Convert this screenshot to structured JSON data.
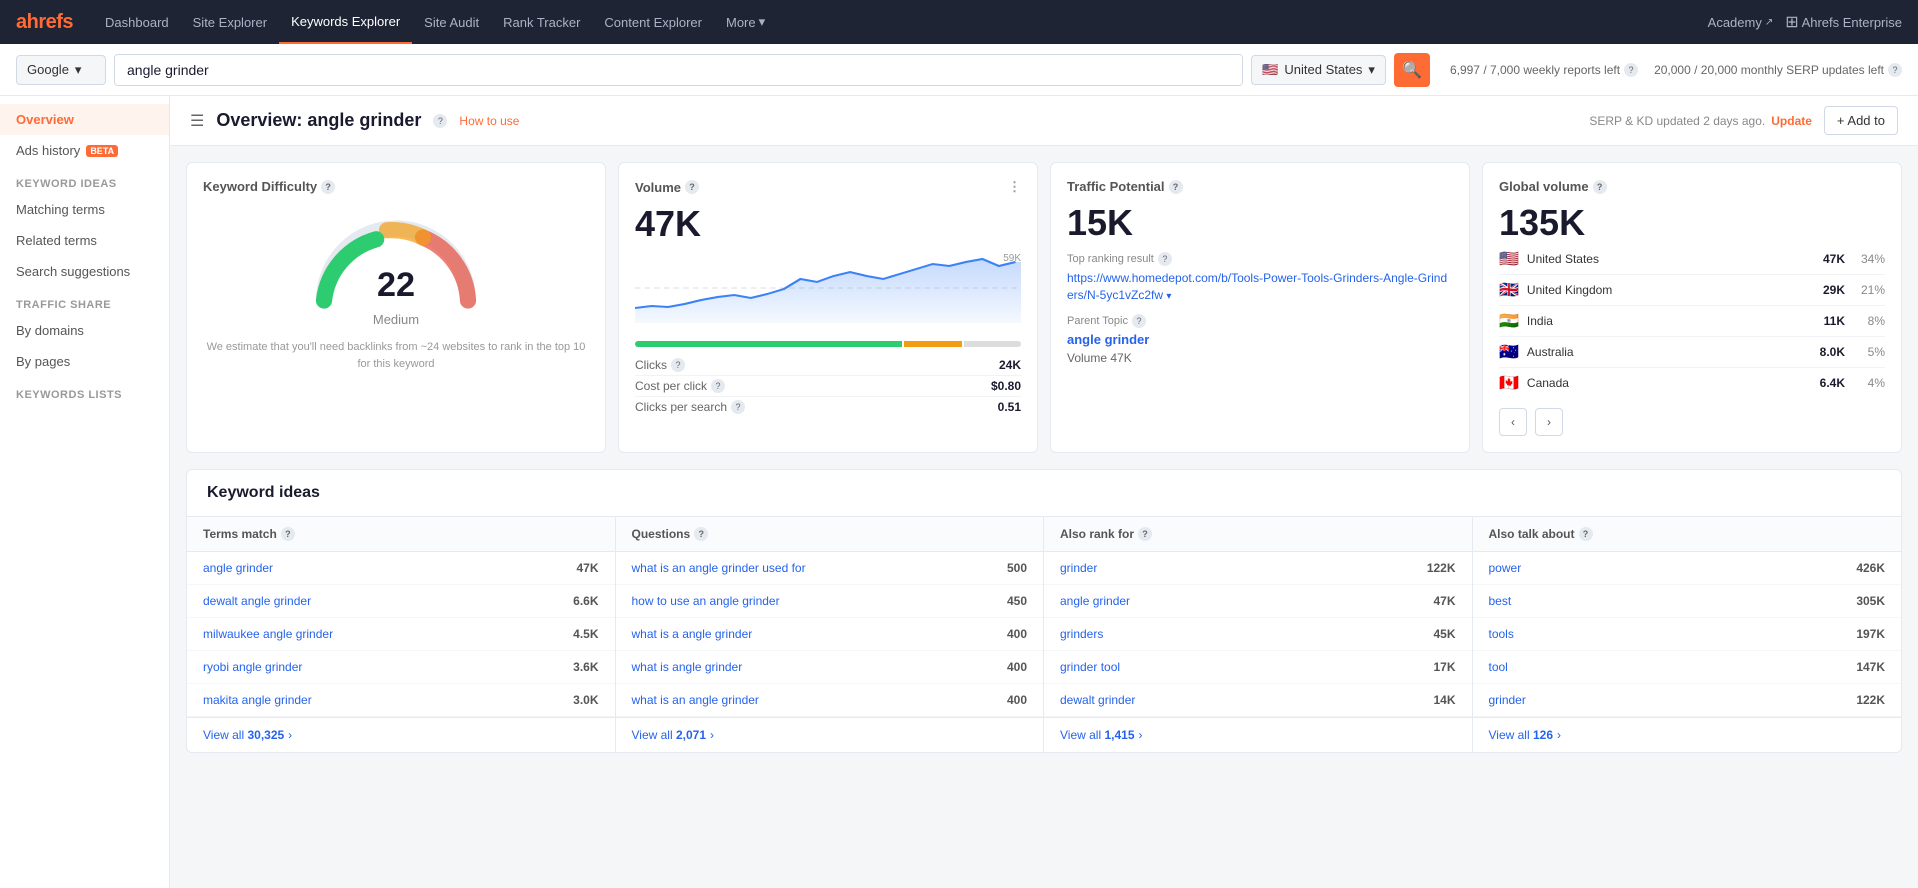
{
  "nav": {
    "logo": "ahrefs",
    "links": [
      {
        "label": "Dashboard",
        "active": false
      },
      {
        "label": "Site Explorer",
        "active": false
      },
      {
        "label": "Keywords Explorer",
        "active": true
      },
      {
        "label": "Site Audit",
        "active": false
      },
      {
        "label": "Rank Tracker",
        "active": false
      },
      {
        "label": "Content Explorer",
        "active": false
      },
      {
        "label": "More",
        "active": false,
        "hasDropdown": true
      }
    ],
    "academy": "Academy",
    "enterprise": "Ahrefs Enterprise"
  },
  "searchBar": {
    "engine": "Google",
    "query": "angle grinder",
    "country": "United States",
    "reports1": "6,997 / 7,000 weekly reports left",
    "reports2": "20,000 / 20,000 monthly SERP updates left"
  },
  "overview": {
    "title": "Overview: angle grinder",
    "howToUse": "How to use",
    "serpUpdate": "SERP & KD updated 2 days ago.",
    "updateLink": "Update",
    "addTo": "+ Add to"
  },
  "sidebar": {
    "overviewLabel": "Overview",
    "adsHistoryLabel": "Ads history",
    "adsHistoryBadge": "BETA",
    "keywordIdeasLabel": "Keyword ideas",
    "matchingTermsLabel": "Matching terms",
    "relatedTermsLabel": "Related terms",
    "searchSuggestionsLabel": "Search suggestions",
    "trafficShareLabel": "Traffic share",
    "byDomainsLabel": "By domains",
    "byPagesLabel": "By pages",
    "keywordsListsLabel": "Keywords lists"
  },
  "cards": {
    "kd": {
      "title": "Keyword Difficulty",
      "value": "22",
      "label": "Medium",
      "note": "We estimate that you'll need backlinks from ~24 websites to rank in the top 10 for this keyword"
    },
    "volume": {
      "title": "Volume",
      "value": "47K",
      "chartMax": "59K",
      "clicks": "24K",
      "cpc": "$0.80",
      "clicksPerSearch": "0.51"
    },
    "traffic": {
      "title": "Traffic Potential",
      "value": "15K",
      "topResultLabel": "Top ranking result",
      "topResultUrl": "https://www.homedepot.com/b/Tools-Power-Tools-Grinders-Angle-Grinders/N-5yc1vZc2fw",
      "parentTopicLabel": "Parent Topic",
      "parentTopicLink": "angle grinder",
      "volumeTag": "Volume 47K"
    },
    "global": {
      "title": "Global volume",
      "value": "135K",
      "countries": [
        {
          "flag": "🇺🇸",
          "name": "United States",
          "vol": "47K",
          "pct": "34%"
        },
        {
          "flag": "🇬🇧",
          "name": "United Kingdom",
          "vol": "29K",
          "pct": "21%"
        },
        {
          "flag": "🇮🇳",
          "name": "India",
          "vol": "11K",
          "pct": "8%"
        },
        {
          "flag": "🇦🇺",
          "name": "Australia",
          "vol": "8.0K",
          "pct": "5%"
        },
        {
          "flag": "🇨🇦",
          "name": "Canada",
          "vol": "6.4K",
          "pct": "4%"
        }
      ]
    }
  },
  "keywordIdeas": {
    "title": "Keyword ideas",
    "columns": [
      {
        "header": "Terms match",
        "items": [
          {
            "label": "angle grinder",
            "value": "47K"
          },
          {
            "label": "dewalt angle grinder",
            "value": "6.6K"
          },
          {
            "label": "milwaukee angle grinder",
            "value": "4.5K"
          },
          {
            "label": "ryobi angle grinder",
            "value": "3.6K"
          },
          {
            "label": "makita angle grinder",
            "value": "3.0K"
          }
        ],
        "viewAll": "View all",
        "viewAllCount": "30,325"
      },
      {
        "header": "Questions",
        "items": [
          {
            "label": "what is an angle grinder used for",
            "value": "500"
          },
          {
            "label": "how to use an angle grinder",
            "value": "450"
          },
          {
            "label": "what is a angle grinder",
            "value": "400"
          },
          {
            "label": "what is angle grinder",
            "value": "400"
          },
          {
            "label": "what is an angle grinder",
            "value": "400"
          }
        ],
        "viewAll": "View all",
        "viewAllCount": "2,071"
      },
      {
        "header": "Also rank for",
        "items": [
          {
            "label": "grinder",
            "value": "122K"
          },
          {
            "label": "angle grinder",
            "value": "47K"
          },
          {
            "label": "grinders",
            "value": "45K"
          },
          {
            "label": "grinder tool",
            "value": "17K"
          },
          {
            "label": "dewalt grinder",
            "value": "14K"
          }
        ],
        "viewAll": "View all",
        "viewAllCount": "1,415"
      },
      {
        "header": "Also talk about",
        "items": [
          {
            "label": "power",
            "value": "426K"
          },
          {
            "label": "best",
            "value": "305K"
          },
          {
            "label": "tools",
            "value": "197K"
          },
          {
            "label": "tool",
            "value": "147K"
          },
          {
            "label": "grinder",
            "value": "122K"
          }
        ],
        "viewAll": "View all",
        "viewAllCount": "126"
      }
    ]
  },
  "volumeChartData": {
    "points": [
      12,
      14,
      13,
      15,
      18,
      20,
      22,
      19,
      24,
      28,
      35,
      32,
      38,
      42,
      38,
      35,
      40,
      45,
      50,
      48,
      52,
      55,
      48,
      52
    ]
  }
}
